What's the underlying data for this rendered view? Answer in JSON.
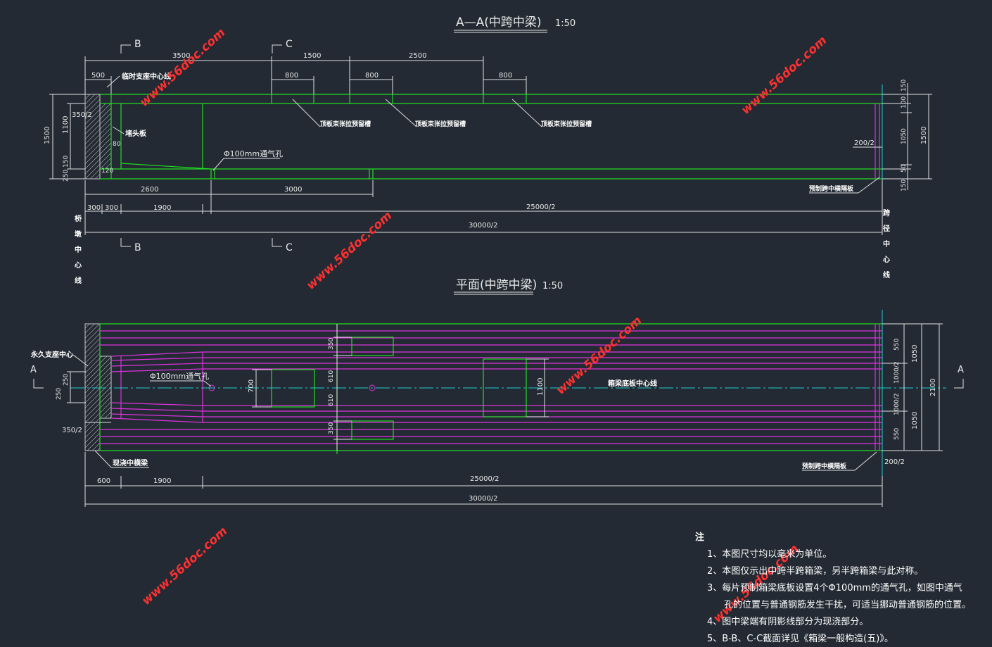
{
  "titles": {
    "section_title": "A—A(中跨中梁)",
    "section_scale": "1:50",
    "plan_title": "平面(中跨中梁)",
    "plan_scale": "1:50"
  },
  "section_marks": {
    "b": "B",
    "c": "C",
    "a": "A"
  },
  "section_view": {
    "dims_top": [
      "3500",
      "1500",
      "2500",
      "500",
      "800",
      "800",
      "800"
    ],
    "dims_left": [
      "1500",
      "1100",
      "350/2",
      "150",
      "250"
    ],
    "dims_inner": [
      "80",
      "120"
    ],
    "dims_right": [
      "150",
      "100",
      "1050",
      "1500",
      "50",
      "150"
    ],
    "dims_bottom": [
      "2600",
      "3000",
      "300",
      "300",
      "1900",
      "25000/2",
      "30000/2"
    ],
    "label_temp_support": "临时支座中心线",
    "label_end_plate": "堵头板",
    "label_groove_1": "顶板束张拉预留槽",
    "label_groove_2": "顶板束张拉预留槽",
    "label_groove_3": "顶板束张拉预留槽",
    "label_vent": "Φ100mm通气孔",
    "label_right_dim": "200/2",
    "label_diaphragm": "预制跨中横隔板",
    "label_pier_center": "桥墩中心线",
    "label_span_center": "跨径中心线"
  },
  "plan_view": {
    "label_perm_support": "永久支座中心",
    "dims_left": [
      "250",
      "250",
      "350/2"
    ],
    "dim_700": "700",
    "dims_mid": [
      "350",
      "610",
      "610",
      "350"
    ],
    "dim_1100": "1100",
    "label_vent": "Φ100mm通气孔",
    "label_bottom_center": "箱梁底板中心线",
    "dims_right": [
      "550",
      "1050",
      "1000/2",
      "1000/2",
      "1050",
      "550",
      "2100"
    ],
    "label_cast_beam": "现浇中横梁",
    "label_diaphragm": "预制跨中横隔板",
    "label_right_dim": "200/2",
    "dims_bottom": [
      "600",
      "1900",
      "25000/2",
      "30000/2"
    ]
  },
  "notes": {
    "title": "注",
    "items": [
      "1、本图尺寸均以毫米为单位。",
      "2、本图仅示出中跨半跨箱梁，另半跨箱梁与此对称。",
      "3、每片预制箱梁底板设置4个Φ100mm的通气孔，如图中通气",
      "孔的位置与普通钢筋发生干扰，可适当挪动普通钢筋的位置。",
      "4、图中梁端有阴影线部分为现浇部分。",
      "5、B-B、C-C截面详见《箱梁一般构造(五)》。"
    ]
  },
  "watermark": "www.56doc.com",
  "colors": {
    "background": "#232a33",
    "structure": "#22dd22",
    "tendon": "#dd33dd",
    "centerline": "#22cccc",
    "watermark": "#ff3030"
  }
}
